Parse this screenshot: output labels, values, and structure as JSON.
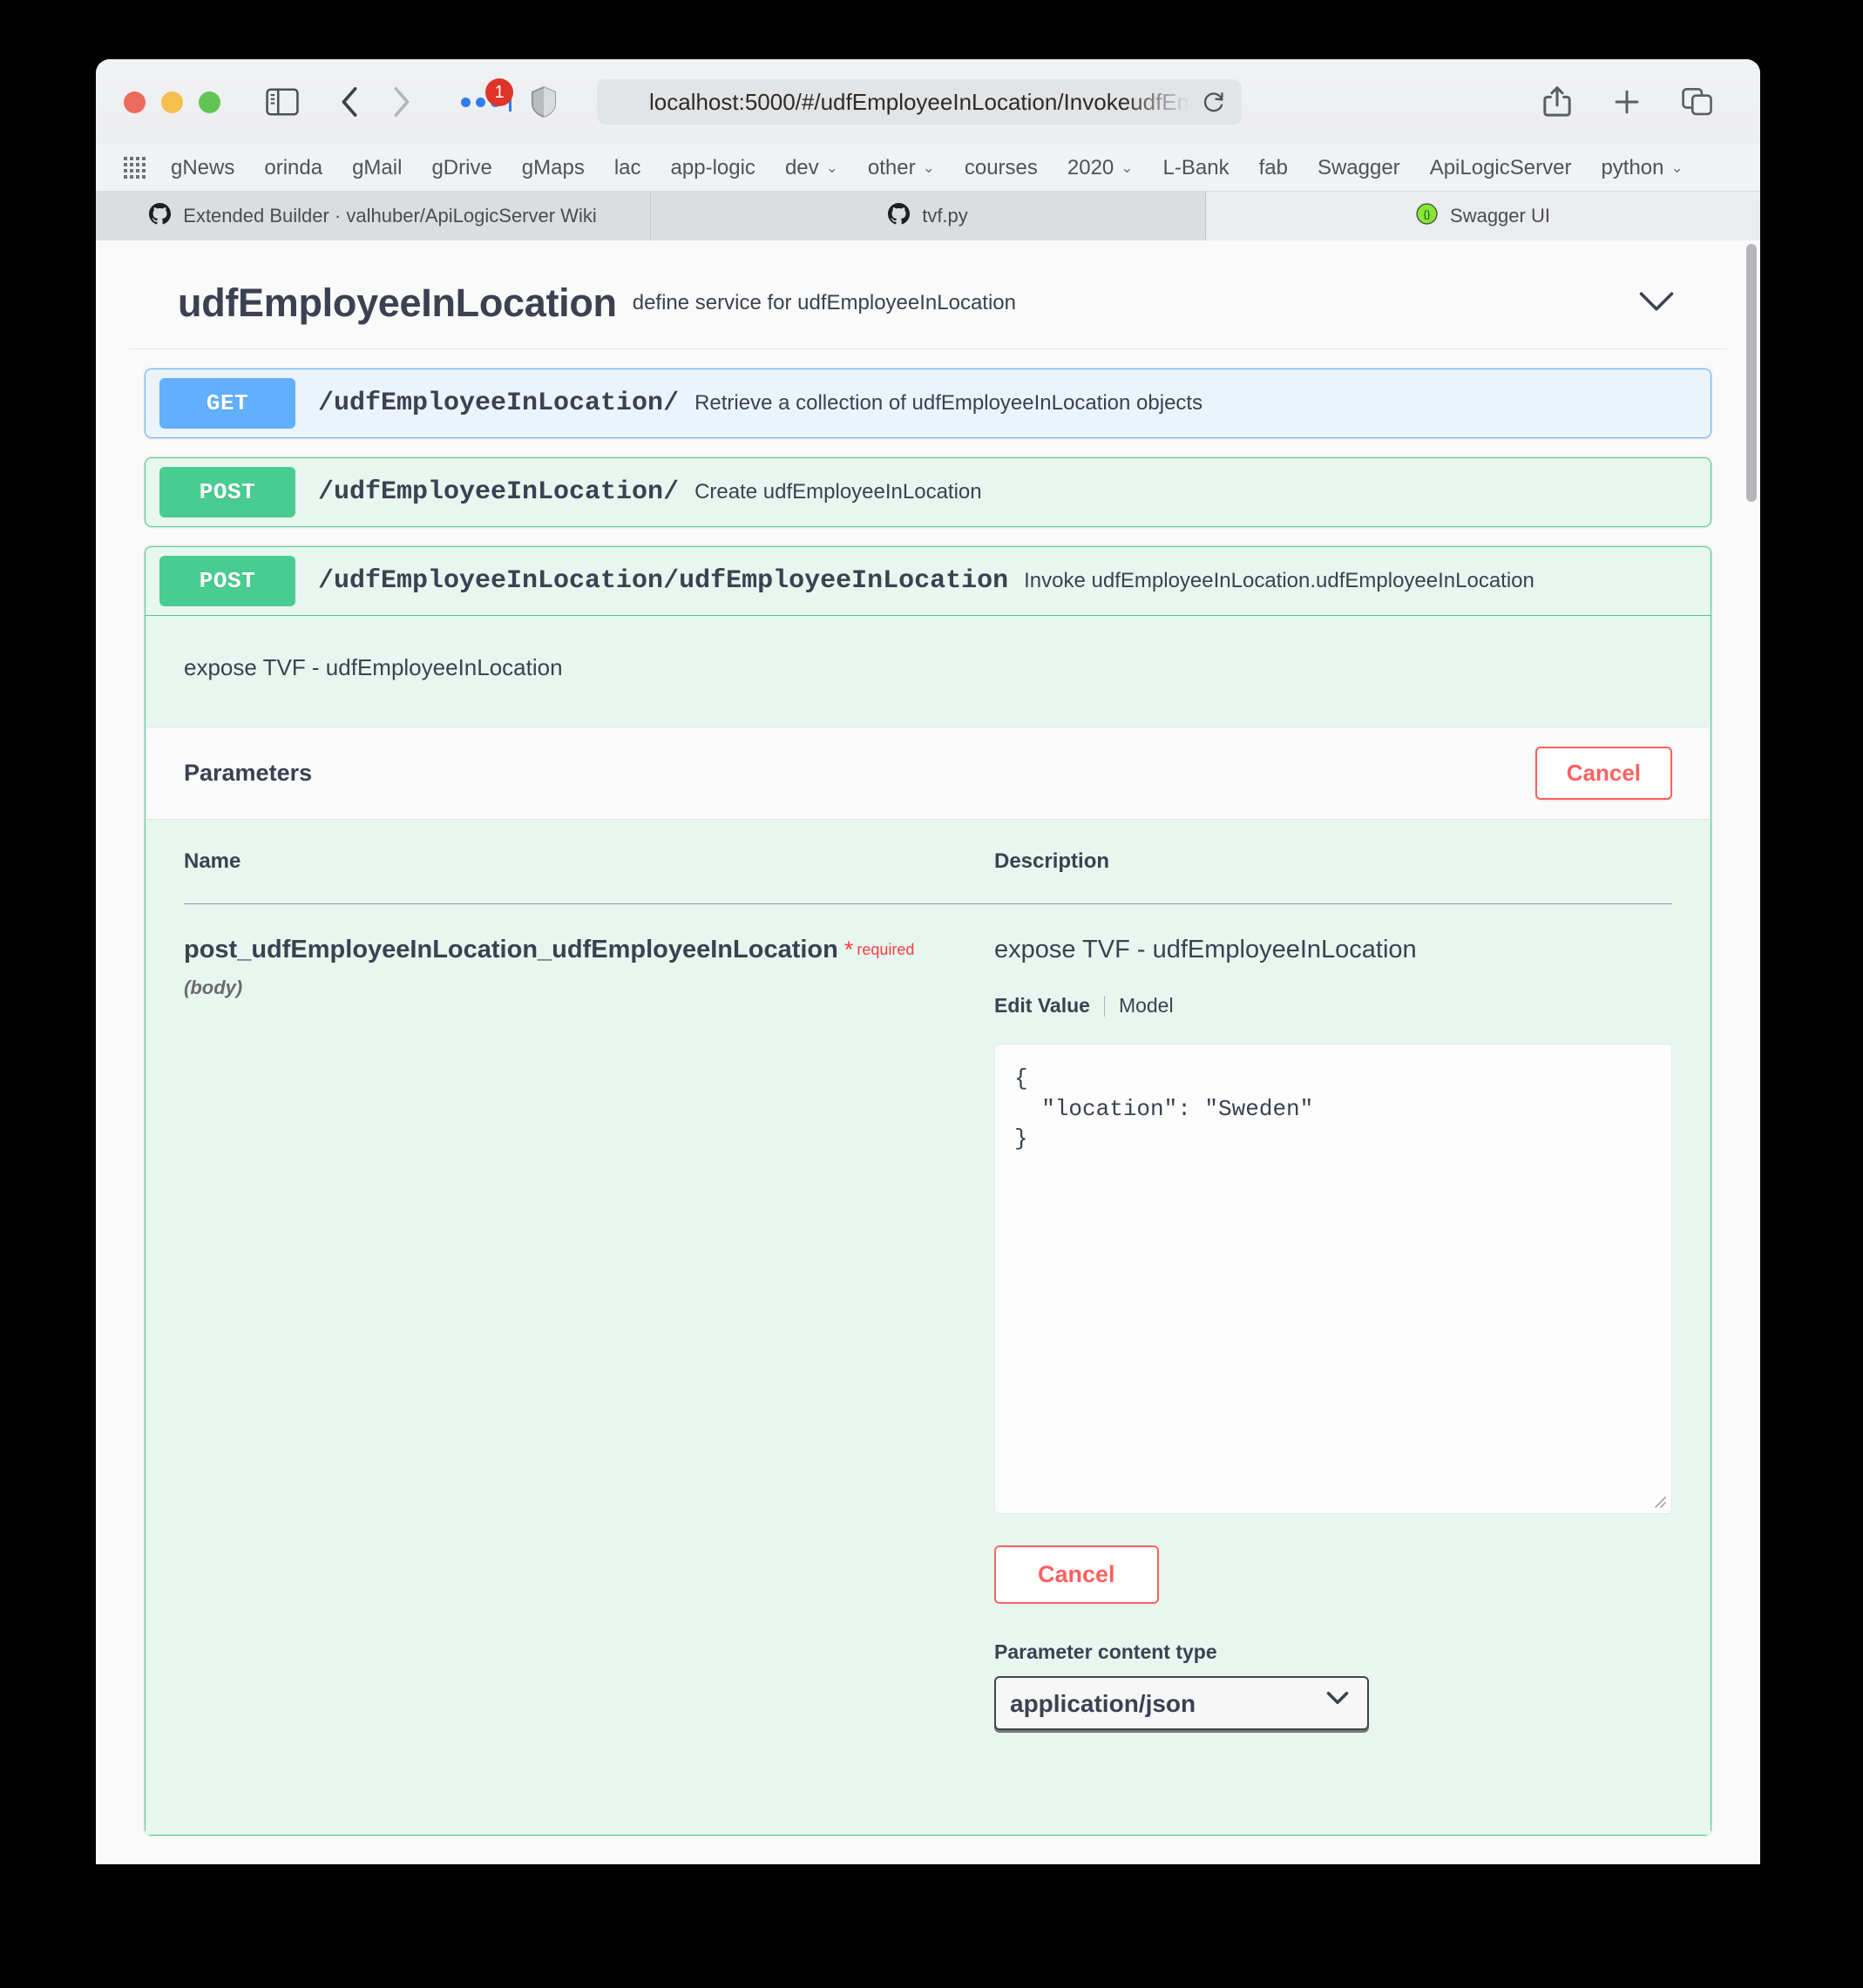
{
  "browser": {
    "url": "localhost:5000/#/udfEmployeeInLocation/InvokeudfEm",
    "extension_badge": "1",
    "bookmarks": [
      {
        "label": "gNews",
        "dropdown": false
      },
      {
        "label": "orinda",
        "dropdown": false
      },
      {
        "label": "gMail",
        "dropdown": false
      },
      {
        "label": "gDrive",
        "dropdown": false
      },
      {
        "label": "gMaps",
        "dropdown": false
      },
      {
        "label": "lac",
        "dropdown": false
      },
      {
        "label": "app-logic",
        "dropdown": false
      },
      {
        "label": "dev",
        "dropdown": true
      },
      {
        "label": "other",
        "dropdown": true
      },
      {
        "label": "courses",
        "dropdown": false
      },
      {
        "label": "2020",
        "dropdown": true
      },
      {
        "label": "L-Bank",
        "dropdown": false
      },
      {
        "label": "fab",
        "dropdown": false
      },
      {
        "label": "Swagger",
        "dropdown": false
      },
      {
        "label": "ApiLogicServer",
        "dropdown": false
      },
      {
        "label": "python",
        "dropdown": true
      }
    ],
    "tabs": [
      {
        "title": "Extended Builder · valhuber/ApiLogicServer Wiki",
        "icon": "github-icon",
        "active": false
      },
      {
        "title": "tvf.py",
        "icon": "github-icon",
        "active": false
      },
      {
        "title": "Swagger UI",
        "icon": "swagger-icon",
        "active": true
      }
    ],
    "chevron_glyph": "⌄"
  },
  "swagger": {
    "tag_title": "udfEmployeeInLocation",
    "tag_description": "define service for udfEmployeeInLocation",
    "operations": [
      {
        "method": "GET",
        "path": "/udfEmployeeInLocation/",
        "summary": "Retrieve a collection of udfEmployeeInLocation objects"
      },
      {
        "method": "POST",
        "path": "/udfEmployeeInLocation/",
        "summary": "Create udfEmployeeInLocation"
      },
      {
        "method": "POST",
        "path": "/udfEmployeeInLocation/udfEmployeeInLocation",
        "summary": "Invoke udfEmployeeInLocation.udfEmployeeInLocation"
      }
    ],
    "expanded": {
      "description": "expose TVF - udfEmployeeInLocation",
      "parameters_title": "Parameters",
      "cancel_label": "Cancel",
      "col_name_header": "Name",
      "col_desc_header": "Description",
      "param_name": "post_udfEmployeeInLocation_udfEmployeeInLocation",
      "param_required_star": "*",
      "param_required_text": "required",
      "param_in": "(body)",
      "param_description": "expose TVF - udfEmployeeInLocation",
      "tab_edit_value": "Edit Value",
      "tab_model": "Model",
      "tab_separator": "|",
      "body_value": "{\n  \"location\": \"Sweden\"\n}",
      "cancel_lg_label": "Cancel",
      "content_type_label": "Parameter content type",
      "content_type_value": "application/json",
      "content_type_options": [
        "application/json"
      ]
    }
  },
  "colors": {
    "get_accent": "#61affe",
    "post_accent": "#49cc90",
    "required_red": "#f93e3e",
    "cancel_red": "#ff6060",
    "text": "#3b4151"
  }
}
